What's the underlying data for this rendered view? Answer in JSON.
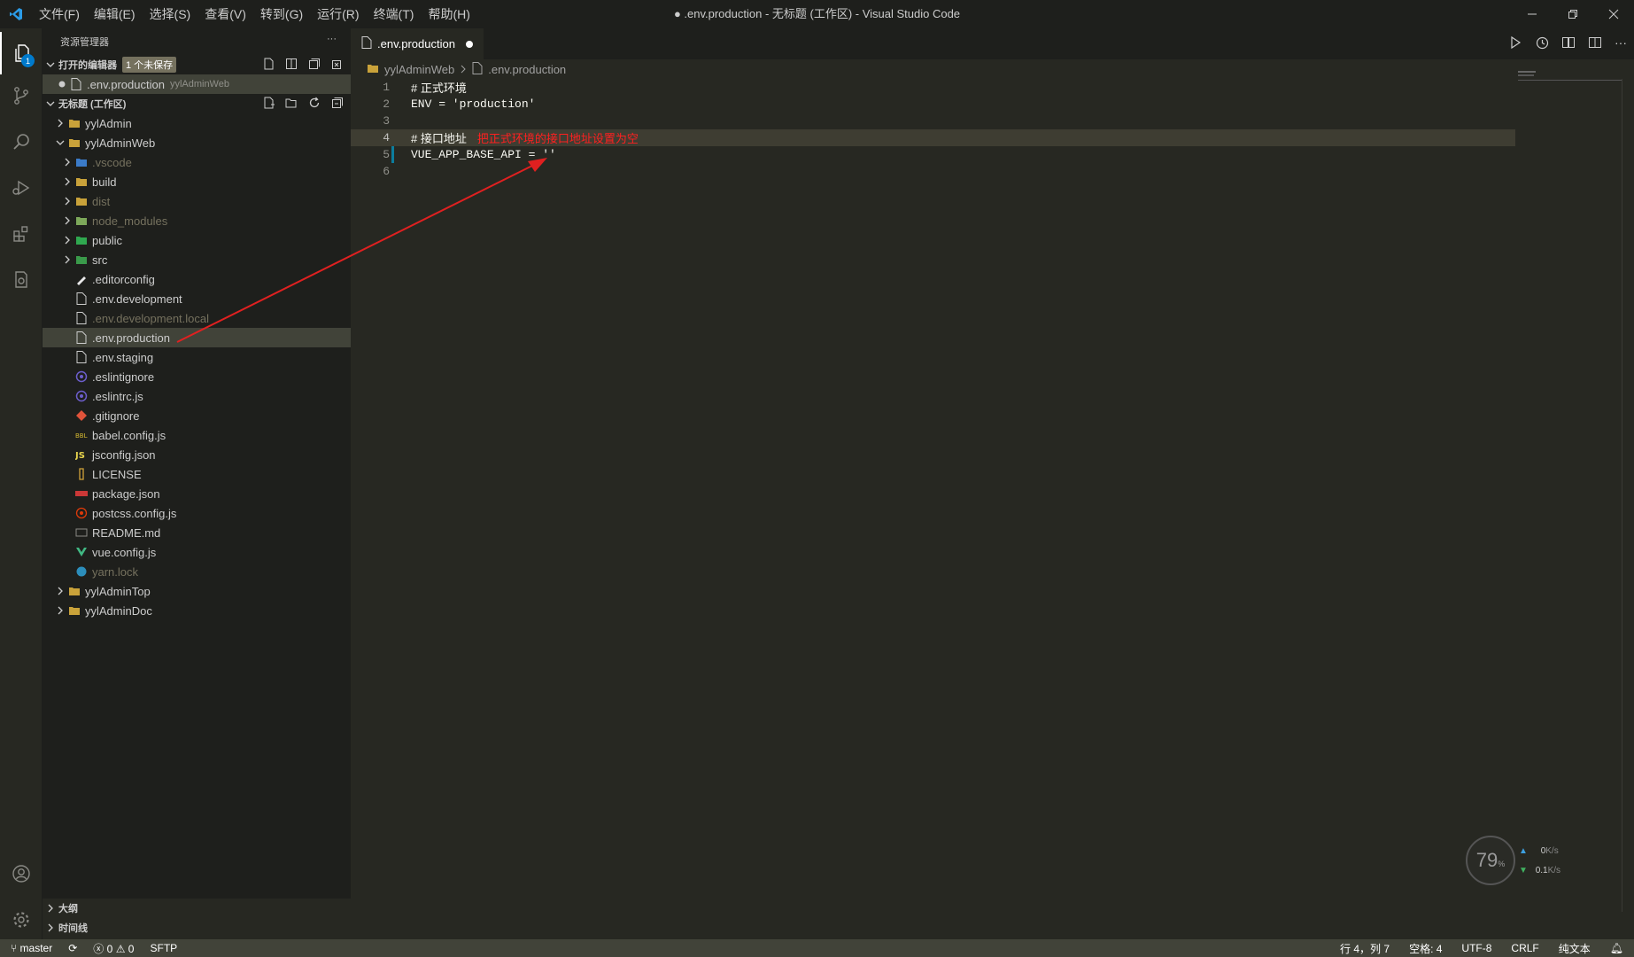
{
  "window": {
    "title": "● .env.production - 无标题 (工作区) - Visual Studio Code",
    "menu": [
      "文件(F)",
      "编辑(E)",
      "选择(S)",
      "查看(V)",
      "转到(G)",
      "运行(R)",
      "终端(T)",
      "帮助(H)"
    ]
  },
  "activity": {
    "explorer_badge": "1"
  },
  "sidebar": {
    "title": "资源管理器",
    "open_editors": {
      "header": "打开的编辑器",
      "unsaved_badge": "1 个未保存",
      "items": [
        {
          "name": ".env.production",
          "desc": "yylAdminWeb"
        }
      ]
    },
    "workspace": {
      "header": "无标题 (工作区)",
      "tree": [
        {
          "name": "yylAdmin",
          "depth": 0,
          "kind": "folder",
          "expanded": false
        },
        {
          "name": "yylAdminWeb",
          "depth": 0,
          "kind": "folder",
          "expanded": true
        },
        {
          "name": ".vscode",
          "depth": 1,
          "kind": "folder-vscode",
          "expanded": false,
          "dim": true
        },
        {
          "name": "build",
          "depth": 1,
          "kind": "folder",
          "expanded": false
        },
        {
          "name": "dist",
          "depth": 1,
          "kind": "folder",
          "expanded": false,
          "dim": true
        },
        {
          "name": "node_modules",
          "depth": 1,
          "kind": "folder-node",
          "expanded": false,
          "dim": true
        },
        {
          "name": "public",
          "depth": 1,
          "kind": "folder-public",
          "expanded": false
        },
        {
          "name": "src",
          "depth": 1,
          "kind": "folder-src",
          "expanded": false
        },
        {
          "name": ".editorconfig",
          "depth": 1,
          "kind": "editorconfig"
        },
        {
          "name": ".env.development",
          "depth": 1,
          "kind": "file"
        },
        {
          "name": ".env.development.local",
          "depth": 1,
          "kind": "file",
          "dim": true
        },
        {
          "name": ".env.production",
          "depth": 1,
          "kind": "file",
          "selected": true
        },
        {
          "name": ".env.staging",
          "depth": 1,
          "kind": "file"
        },
        {
          "name": ".eslintignore",
          "depth": 1,
          "kind": "eslint"
        },
        {
          "name": ".eslintrc.js",
          "depth": 1,
          "kind": "eslint"
        },
        {
          "name": ".gitignore",
          "depth": 1,
          "kind": "git"
        },
        {
          "name": "babel.config.js",
          "depth": 1,
          "kind": "babel"
        },
        {
          "name": "jsconfig.json",
          "depth": 1,
          "kind": "js"
        },
        {
          "name": "LICENSE",
          "depth": 1,
          "kind": "license"
        },
        {
          "name": "package.json",
          "depth": 1,
          "kind": "npm"
        },
        {
          "name": "postcss.config.js",
          "depth": 1,
          "kind": "postcss"
        },
        {
          "name": "README.md",
          "depth": 1,
          "kind": "readme"
        },
        {
          "name": "vue.config.js",
          "depth": 1,
          "kind": "vue"
        },
        {
          "name": "yarn.lock",
          "depth": 1,
          "kind": "yarn",
          "dim": true
        },
        {
          "name": "yylAdminTop",
          "depth": 0,
          "kind": "folder",
          "expanded": false
        },
        {
          "name": "yylAdminDoc",
          "depth": 0,
          "kind": "folder",
          "expanded": false
        }
      ]
    },
    "outline": "大纲",
    "timeline": "时间线"
  },
  "editor": {
    "tab": ".env.production",
    "breadcrumb": [
      "yylAdminWeb",
      ".env.production"
    ],
    "lines": [
      {
        "n": "1",
        "text": "# 正式环境"
      },
      {
        "n": "2",
        "text": "ENV = 'production'"
      },
      {
        "n": "3",
        "text": ""
      },
      {
        "n": "4",
        "text": "# 接口地址",
        "annotation": "把正式环境的接口地址设置为空",
        "current": true
      },
      {
        "n": "5",
        "text": "VUE_APP_BASE_API = ''"
      },
      {
        "n": "6",
        "text": ""
      }
    ]
  },
  "network_widget": {
    "percent": "79",
    "unit": "%",
    "up": "0",
    "up_unit": "K/s",
    "down": "0.1",
    "down_unit": "K/s"
  },
  "statusbar": {
    "branch": "master",
    "errors": "0",
    "warnings": "0",
    "sftp": "SFTP",
    "position": "行 4，列 7",
    "spaces": "空格: 4",
    "encoding": "UTF-8",
    "eol": "CRLF",
    "language": "纯文本"
  },
  "colors": {
    "annotation": "#ff2020",
    "selection": "#414339",
    "accent": "#007acc"
  }
}
